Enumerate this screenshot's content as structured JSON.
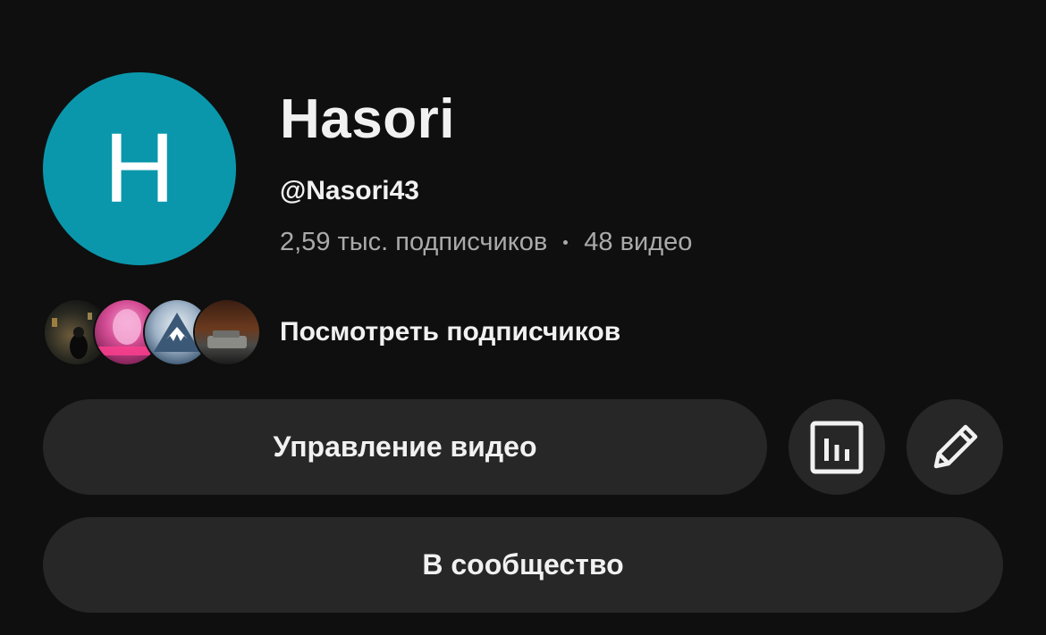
{
  "channel": {
    "avatar_letter": "H",
    "avatar_color": "#0a97ab",
    "name": "Hasori",
    "handle": "@Nasori43",
    "subscribers": "2,59 тыс. подписчиков",
    "videos": "48 видео"
  },
  "subscribers_row": {
    "label": "Посмотреть подписчиков",
    "avatars": [
      "subscriber-avatar-1",
      "subscriber-avatar-2",
      "subscriber-avatar-3",
      "subscriber-avatar-4"
    ]
  },
  "actions": {
    "manage_videos_label": "Управление видео",
    "stats_icon": "bar-chart-icon",
    "edit_icon": "pencil-icon",
    "community_label": "В сообщество"
  },
  "colors": {
    "background": "#0f0f0f",
    "button_bg": "#272727",
    "primary_text": "#f1f1f1",
    "secondary_text": "#aaaaaa"
  }
}
